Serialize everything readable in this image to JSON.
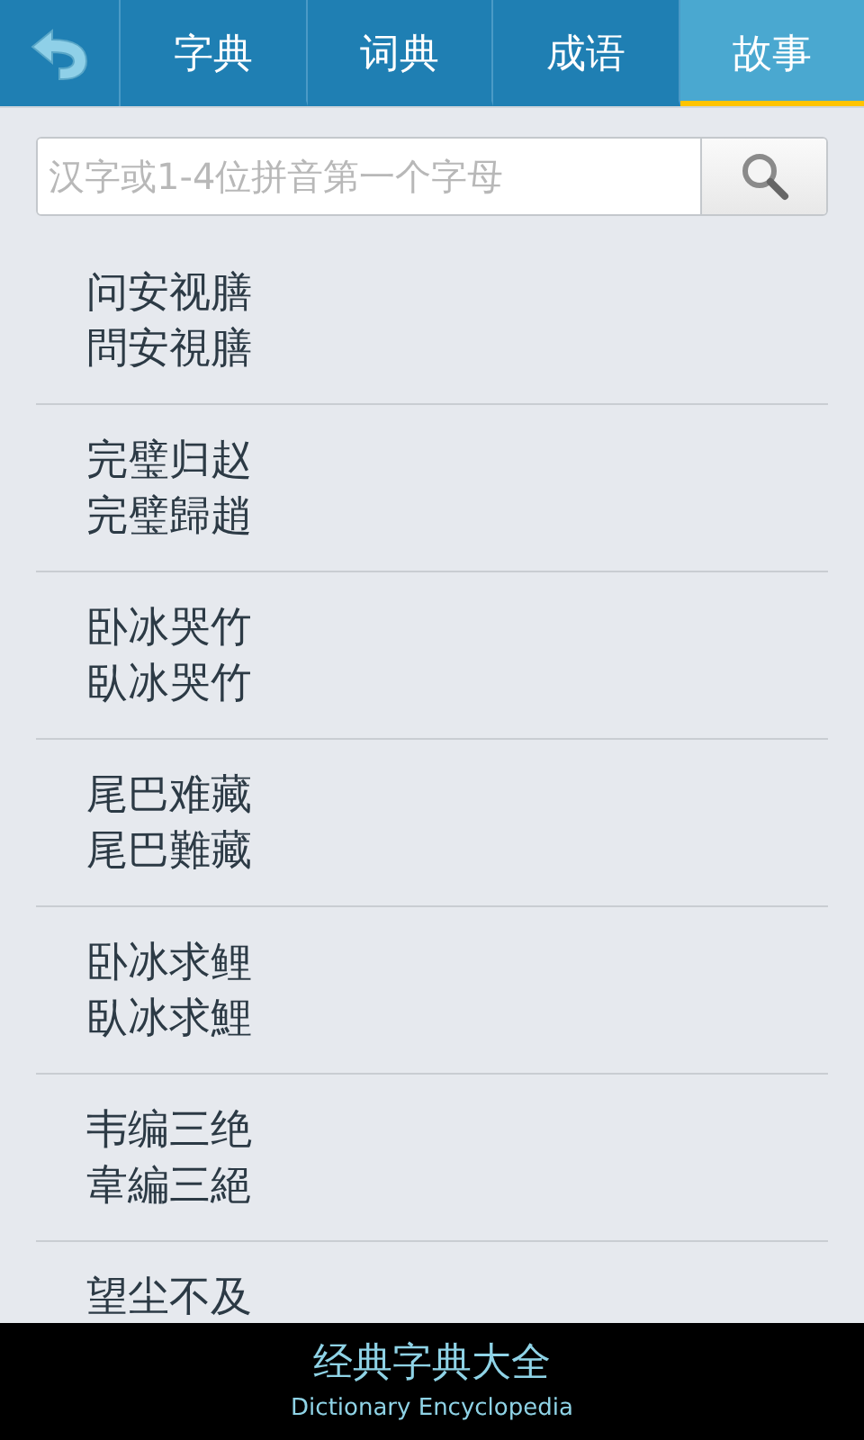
{
  "tabs": [
    {
      "label": "字典",
      "selected": false
    },
    {
      "label": "词典",
      "selected": false
    },
    {
      "label": "成语",
      "selected": false
    },
    {
      "label": "故事",
      "selected": true
    }
  ],
  "search": {
    "placeholder": "汉字或1-4位拼音第一个字母"
  },
  "stories": [
    {
      "simplified": "问安视膳",
      "traditional": "問安視膳"
    },
    {
      "simplified": "完璧归赵",
      "traditional": "完璧歸趙"
    },
    {
      "simplified": "卧冰哭竹",
      "traditional": "臥冰哭竹"
    },
    {
      "simplified": "尾巴难藏",
      "traditional": "尾巴難藏"
    },
    {
      "simplified": "卧冰求鲤",
      "traditional": "臥冰求鯉"
    },
    {
      "simplified": "韦编三绝",
      "traditional": "韋編三絕"
    },
    {
      "simplified": "望尘不及"
    }
  ],
  "banner": {
    "title": "经典字典大全",
    "subtitle": "Dictionary Encyclopedia"
  }
}
